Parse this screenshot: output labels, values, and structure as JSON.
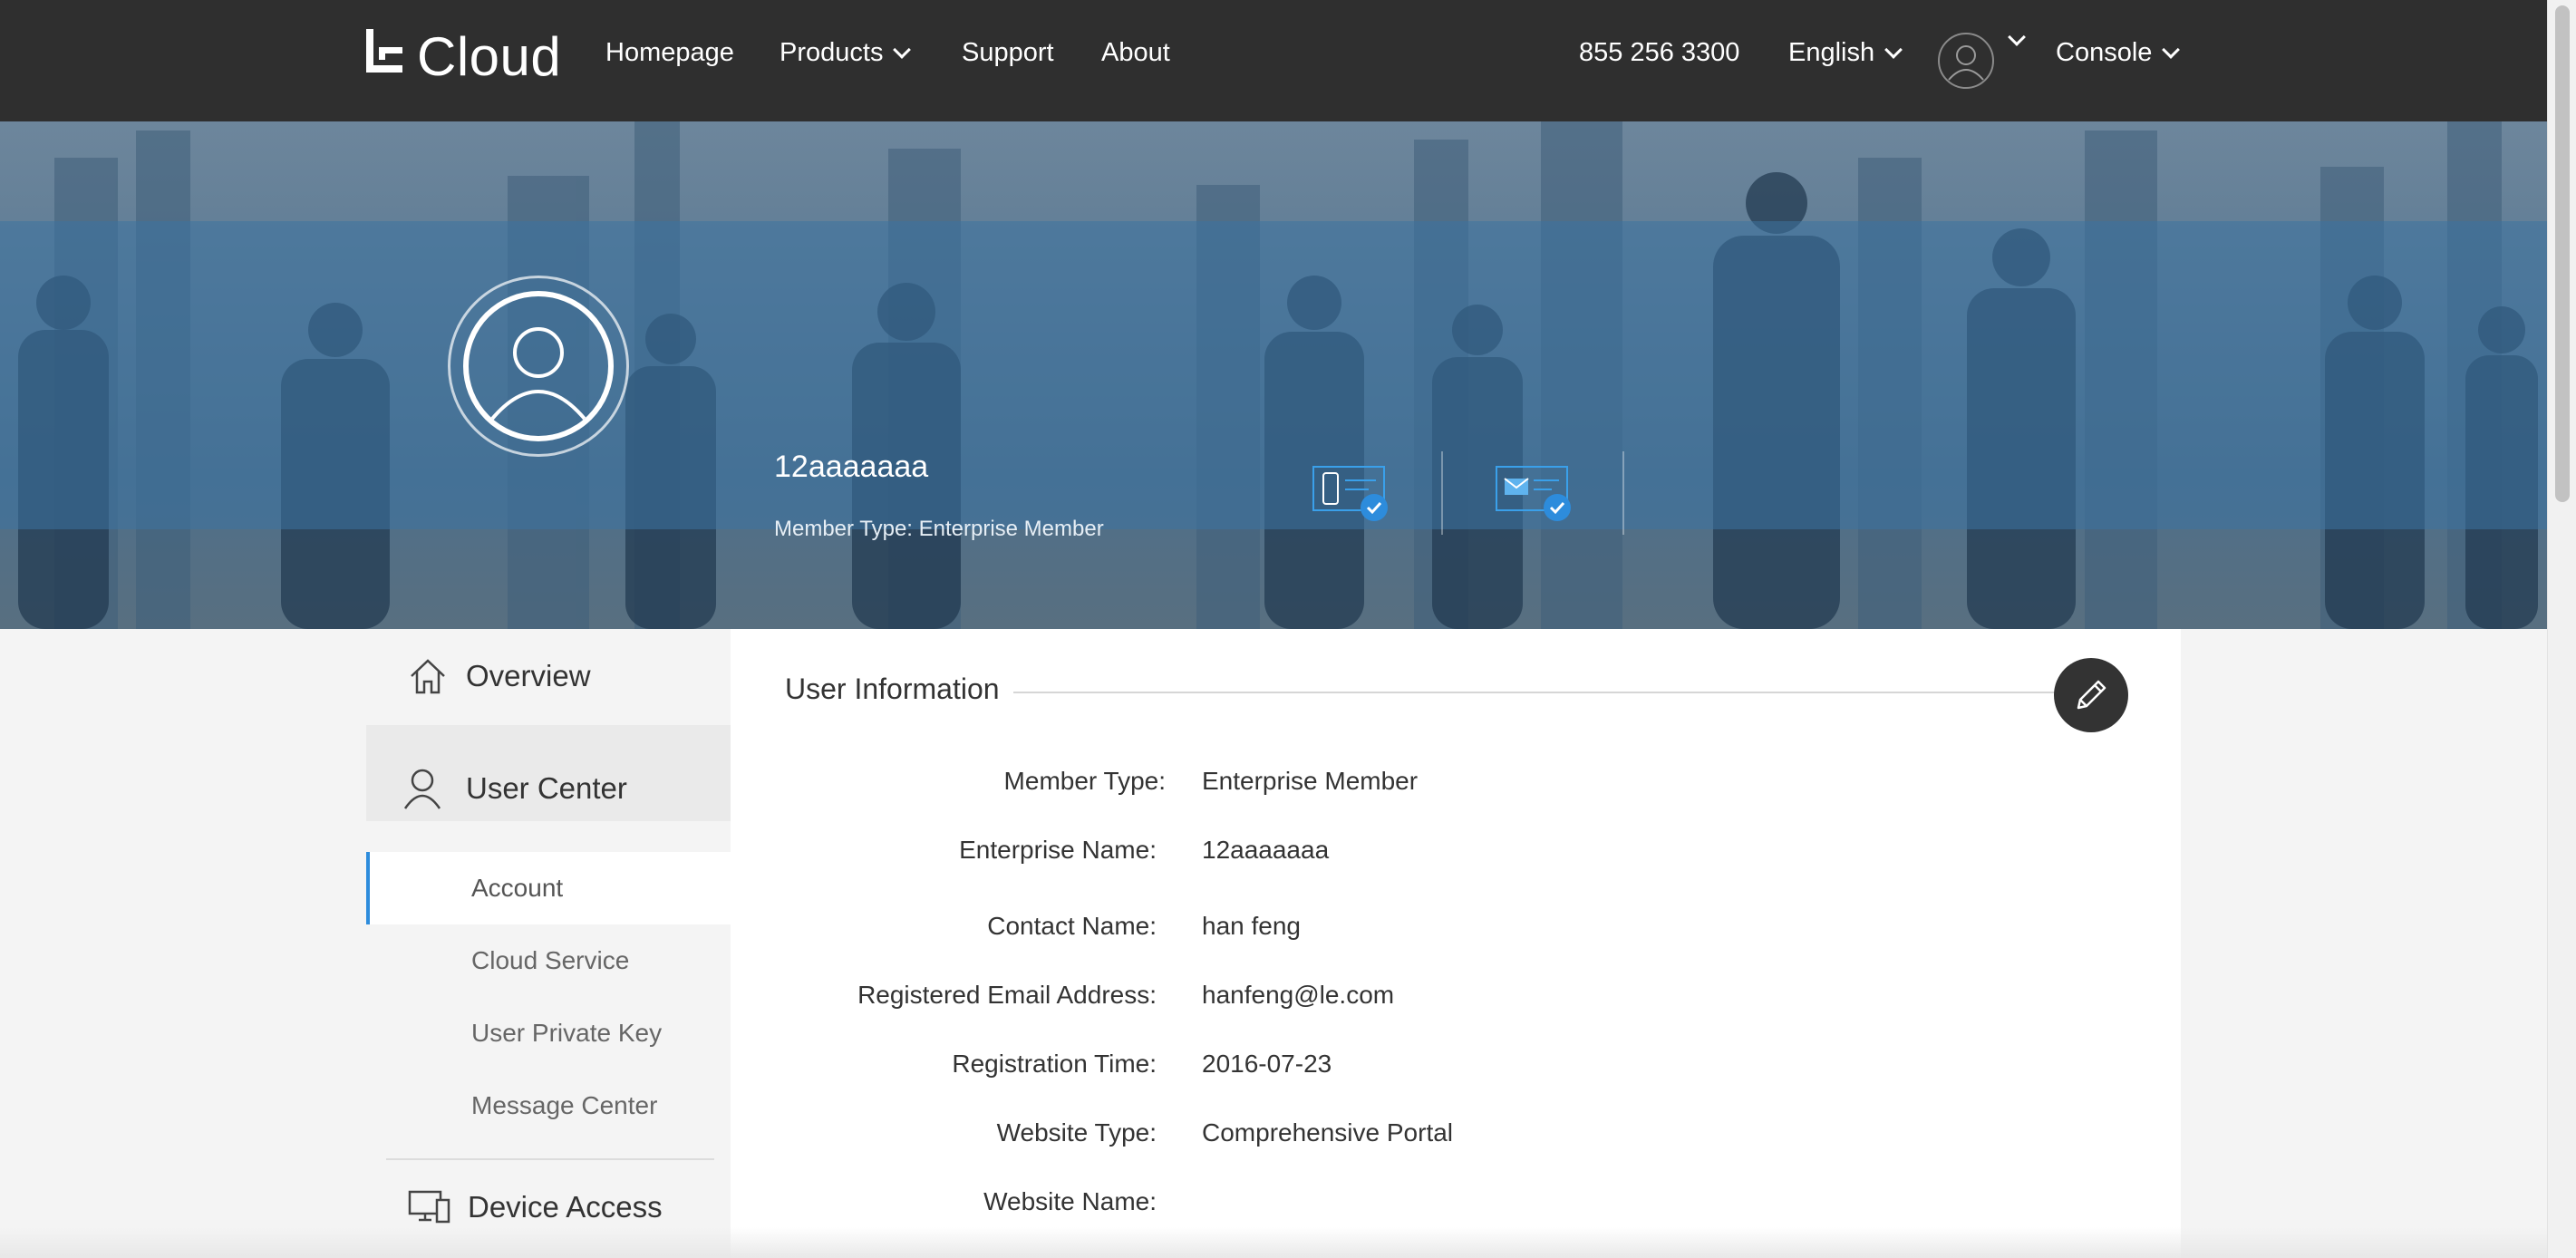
{
  "brand": {
    "logo_text": "Cloud"
  },
  "nav": {
    "homepage": "Homepage",
    "products": "Products",
    "support": "Support",
    "about": "About",
    "phone": "855 256 3300",
    "language": "English",
    "console": "Console"
  },
  "hero": {
    "username": "12aaaaaaa",
    "member_type": "Member Type: Enterprise Member",
    "accent": "#2d8cdc"
  },
  "sidebar": {
    "overview": "Overview",
    "user_center": "User Center",
    "items": [
      {
        "label": "Account",
        "active": true
      },
      {
        "label": "Cloud Service",
        "active": false
      },
      {
        "label": "User Private Key",
        "active": false
      },
      {
        "label": "Message Center",
        "active": false
      }
    ],
    "device_access": "Device Access"
  },
  "user_info": {
    "title": "User Information",
    "rows": [
      {
        "label": "Member Type:",
        "value": "Enterprise Member"
      },
      {
        "label": "Enterprise Name:",
        "value": "12aaaaaaa"
      },
      {
        "label": "Contact Name:",
        "value": "han feng"
      },
      {
        "label": "Registered Email Address:",
        "value": "hanfeng@le.com"
      },
      {
        "label": "Registration Time:",
        "value": "2016-07-23"
      },
      {
        "label": "Website Type:",
        "value": "Comprehensive Portal"
      },
      {
        "label": "Website Name:",
        "value": ""
      }
    ]
  }
}
